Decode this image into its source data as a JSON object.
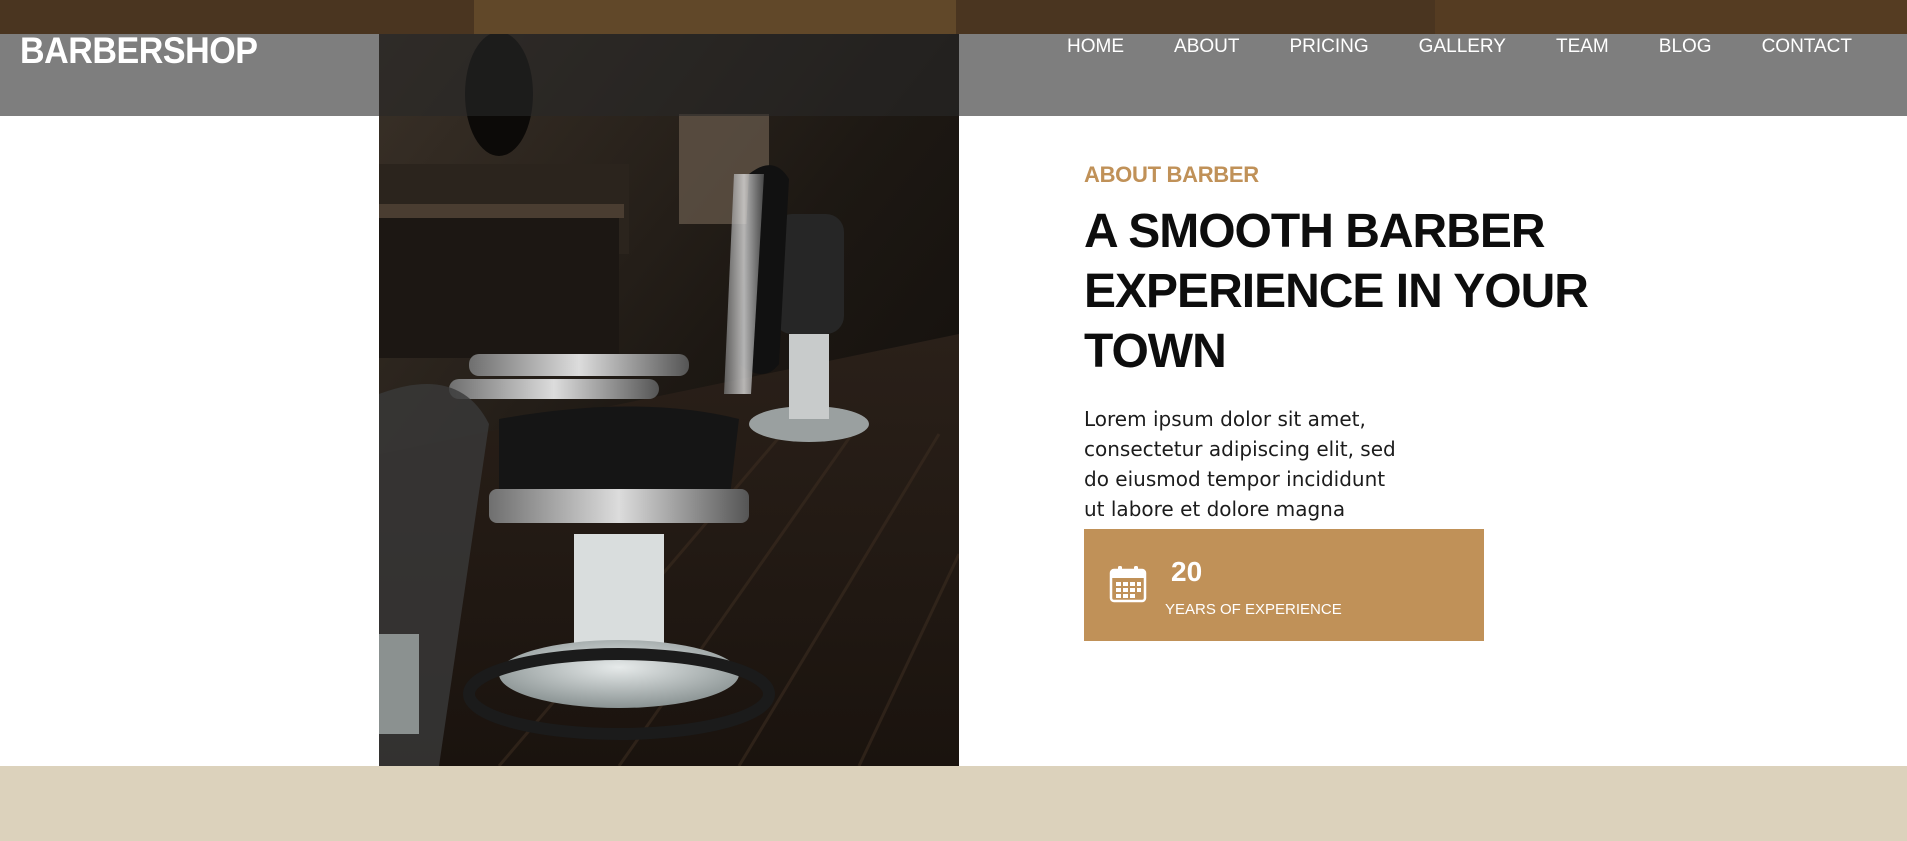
{
  "brand": {
    "name": "BARBERSHOP"
  },
  "nav": {
    "items": [
      {
        "label": "HOME"
      },
      {
        "label": "ABOUT"
      },
      {
        "label": "PRICING"
      },
      {
        "label": "GALLERY"
      },
      {
        "label": "TEAM"
      },
      {
        "label": "BLOG"
      },
      {
        "label": "CONTACT"
      }
    ]
  },
  "about": {
    "eyebrow": "ABOUT BARBER",
    "headline": "A SMOOTH BARBER EXPERIENCE IN YOUR TOWN",
    "body": "Lorem ipsum dolor sit amet, consectetur adipiscing elit, sed do eiusmod tempor incididunt ut labore et dolore magna aliqua. Ut enim ad minim veniam, quis nostrud",
    "stat": {
      "value": "20",
      "label": "YEARS OF EXPERIENCE",
      "icon": "calendar-icon"
    }
  },
  "colors": {
    "accent": "#c09158",
    "header_overlay": "rgba(40,40,40,0.6)",
    "bottom_band": "#dcd2bc",
    "headline": "#0d0d0d"
  }
}
